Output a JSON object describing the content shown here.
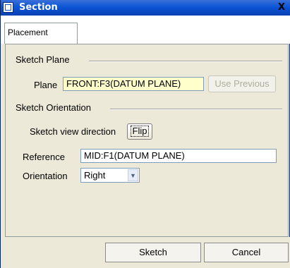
{
  "window": {
    "title": "Section",
    "close_symbol": "X"
  },
  "tabs": [
    {
      "label": "Placement",
      "active": true
    }
  ],
  "sketch_plane": {
    "group_label": "Sketch Plane",
    "plane_label": "Plane",
    "plane_value": "FRONT:F3(DATUM PLANE)",
    "use_previous_label": "Use Previous"
  },
  "sketch_orientation": {
    "group_label": "Sketch Orientation",
    "view_direction_label": "Sketch view direction",
    "flip_label": "Flip",
    "reference_label": "Reference",
    "reference_value": "MID:F1(DATUM PLANE)",
    "orientation_label": "Orientation",
    "orientation_value": "Right"
  },
  "footer": {
    "sketch_label": "Sketch",
    "cancel_label": "Cancel"
  },
  "colors": {
    "plane_field_bg": "#ffffcc",
    "title_bar": "#0b55d6",
    "dialog_bg": "#ece9d8"
  }
}
